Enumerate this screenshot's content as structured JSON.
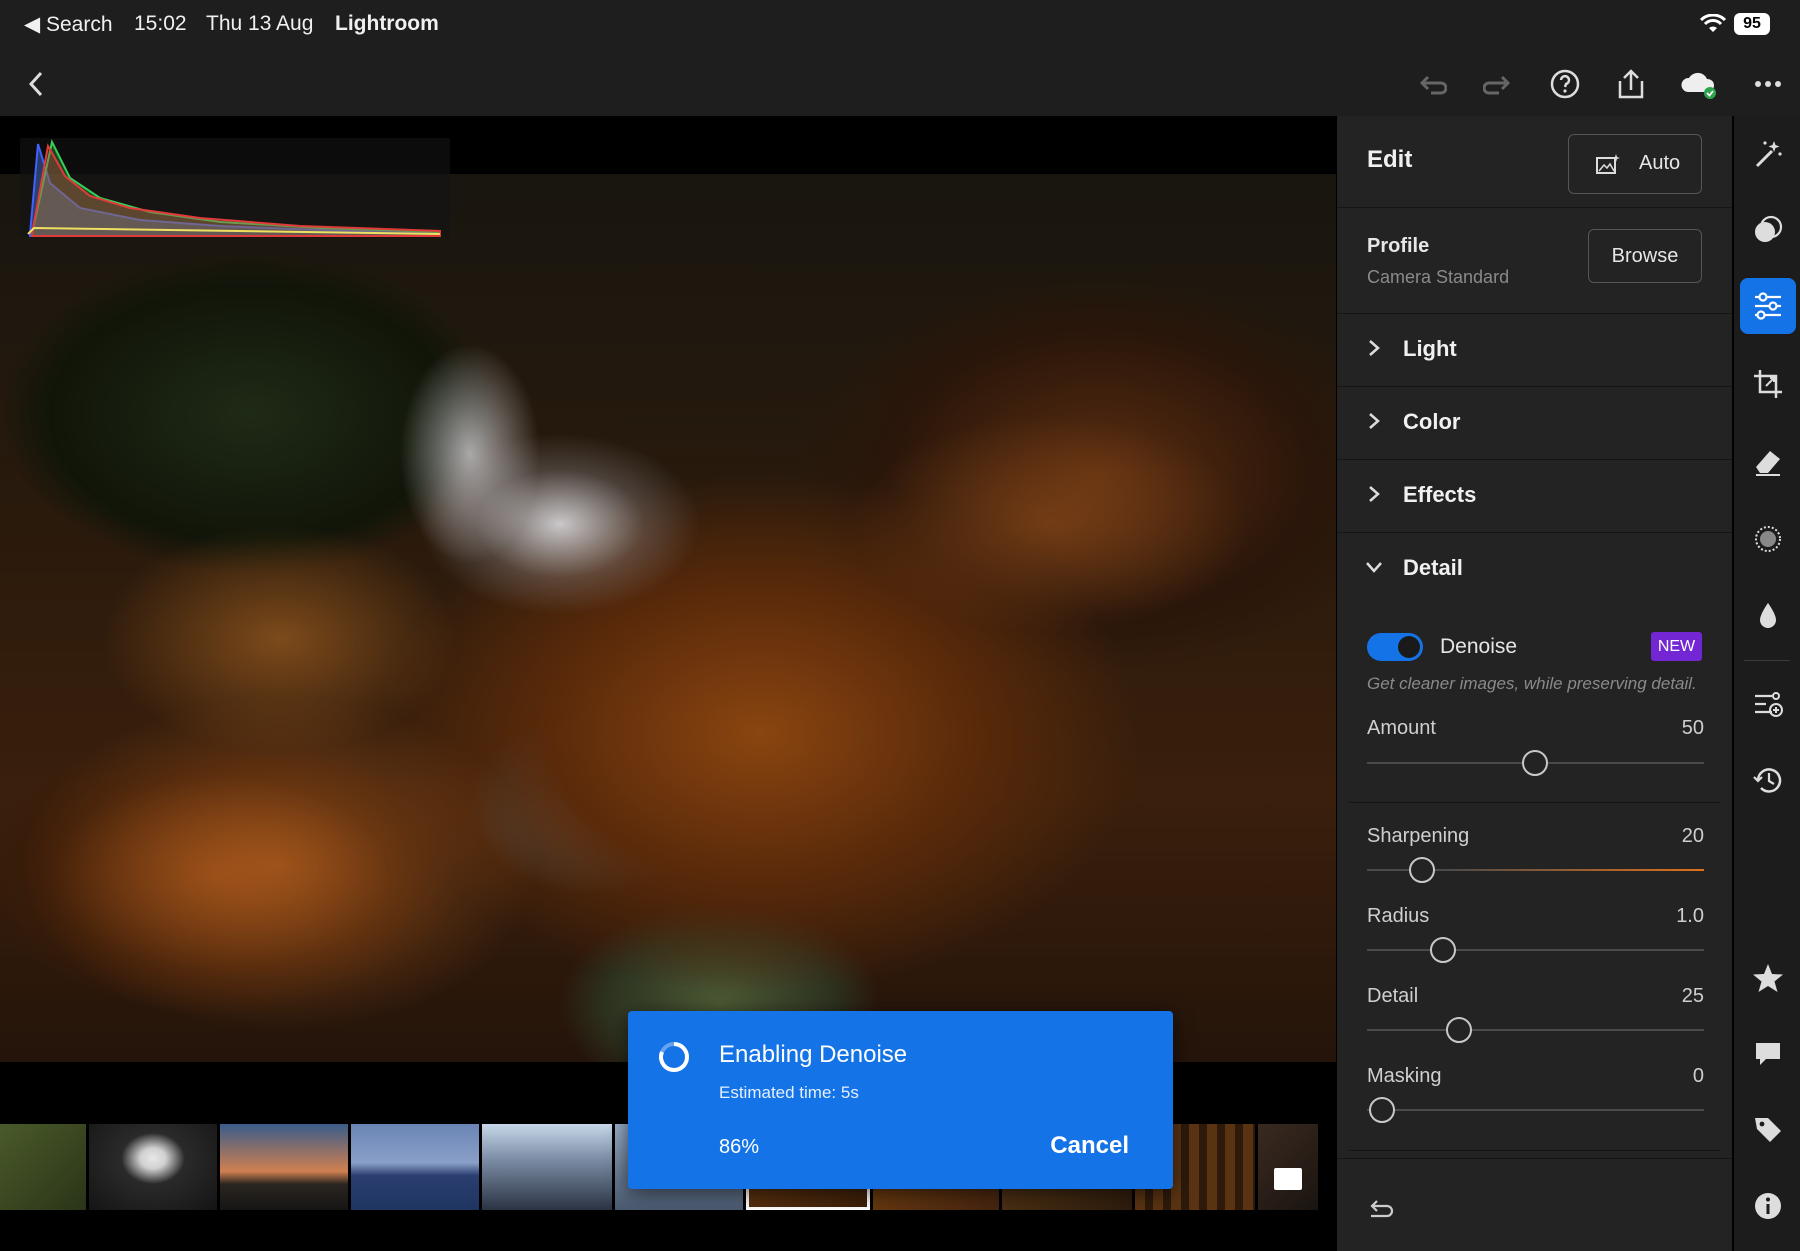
{
  "status_bar": {
    "back_app": "◀ Search",
    "time": "15:02",
    "date": "Thu 13 Aug",
    "app_name": "Lightroom",
    "battery": "95"
  },
  "edit_panel": {
    "title": "Edit",
    "auto_label": "Auto",
    "profile_label": "Profile",
    "profile_value": "Camera Standard",
    "browse_label": "Browse",
    "sections": [
      {
        "label": "Light",
        "expanded": false
      },
      {
        "label": "Color",
        "expanded": false
      },
      {
        "label": "Effects",
        "expanded": false
      },
      {
        "label": "Detail",
        "expanded": true
      }
    ],
    "detail": {
      "denoise_label": "Denoise",
      "denoise_on": true,
      "new_badge": "NEW",
      "denoise_hint": "Get cleaner images, while preserving detail.",
      "amount": {
        "label": "Amount",
        "value": "50"
      },
      "sharpening": {
        "label": "Sharpening",
        "value": "20"
      },
      "radius": {
        "label": "Radius",
        "value": "1.0"
      },
      "detail": {
        "label": "Detail",
        "value": "25"
      },
      "masking": {
        "label": "Masking",
        "value": "0"
      }
    }
  },
  "toast": {
    "title": "Enabling Denoise",
    "subtitle": "Estimated time: 5s",
    "progress_label": "86%",
    "progress": 0.86,
    "cancel_label": "Cancel"
  },
  "colors": {
    "accent": "#1473e6",
    "new_badge": "#7326d3",
    "panel_bg": "#232323",
    "sharpening_track": "#e0701a"
  },
  "rail_icons": [
    "auto-wand-icon",
    "presets-icon",
    "edit-sliders-icon",
    "crop-icon",
    "healing-eraser-icon",
    "masking-icon",
    "color-mix-drop-icon",
    "versions-icon",
    "history-icon",
    "star-icon",
    "comment-icon",
    "tag-icon",
    "info-icon"
  ]
}
